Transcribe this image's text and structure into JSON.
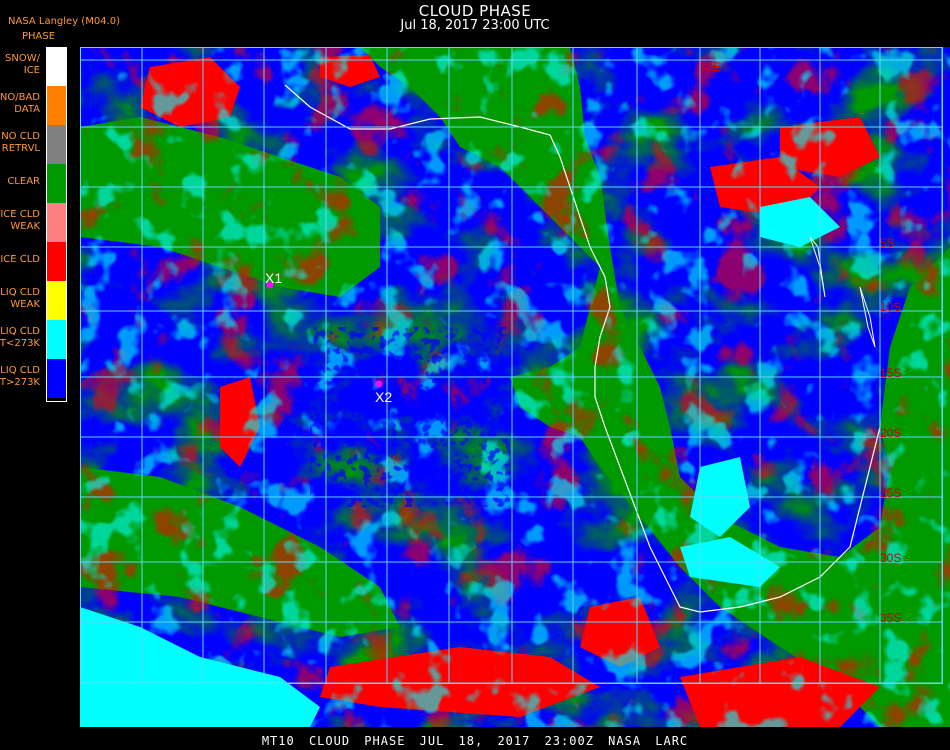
{
  "header": {
    "title": "CLOUD PHASE",
    "subtitle": "Jul 18, 2017 23:00 UTC",
    "agency": "NASA Langley (M04.0)"
  },
  "legend": {
    "title": "PHASE",
    "items": [
      {
        "label": "SNOW/\nICE",
        "color": "#ffffff"
      },
      {
        "label": "NO/BAD\nDATA",
        "color": "#ff8000"
      },
      {
        "label": "NO CLD\nRETRVL",
        "color": "#808080"
      },
      {
        "label": "CLEAR",
        "color": "#009900"
      },
      {
        "label": "ICE CLD\nWEAK",
        "color": "#ff8080"
      },
      {
        "label": "ICE CLD",
        "color": "#ff0000"
      },
      {
        "label": "LIQ CLD\nWEAK",
        "color": "#ffff00"
      },
      {
        "label": "LIQ CLD\nT<273K",
        "color": "#00ffff"
      },
      {
        "label": "LIQ CLD\nT>273K",
        "color": "#0000ff"
      }
    ]
  },
  "map": {
    "grid_color": "#5fd7ff",
    "coast_color": "#ffffff",
    "markers": [
      {
        "label": "X1",
        "color": "#ff00ff"
      },
      {
        "label": "X2",
        "color": "#ff00ff"
      }
    ],
    "lat_labels": [
      "5S",
      "10S",
      "15S",
      "20S",
      "25S",
      "30S",
      "35S"
    ],
    "top_label": "10E"
  },
  "footer": {
    "text": "MT10  CLOUD PHASE   JUL 18, 2017 23:00Z   NASA LARC"
  }
}
